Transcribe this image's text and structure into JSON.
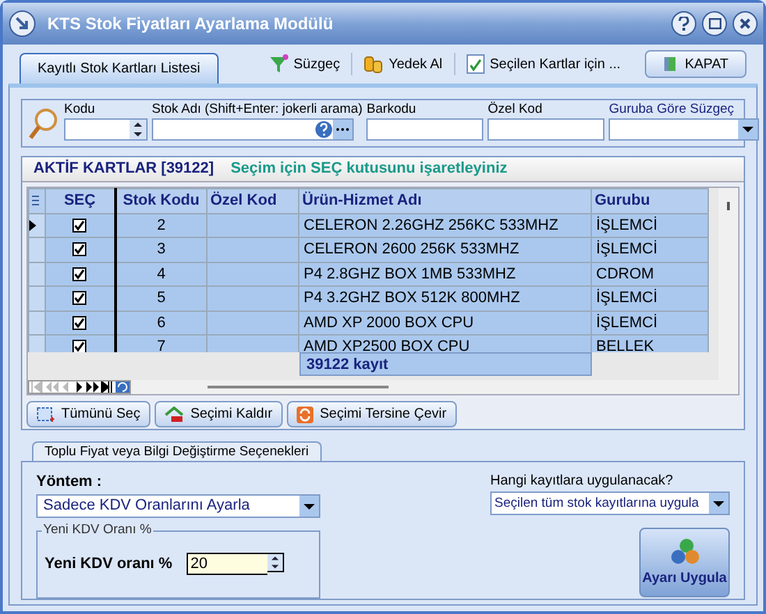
{
  "window": {
    "title": "KTS Stok Fiyatları Ayarlama Modülü"
  },
  "tabs": [
    {
      "label": "Kayıtlı Stok Kartları Listesi",
      "selected": true
    }
  ],
  "toolbar": [
    {
      "label": "Süzgeç",
      "kind": "filter"
    },
    {
      "label": "Yedek Al",
      "kind": "backup"
    },
    {
      "label": "Seçilen Kartlar için ...",
      "kind": "checklist"
    }
  ],
  "close_button": "KAPAT",
  "filters": [
    {
      "label": "Kodu",
      "kind": "spin"
    },
    {
      "label": "Stok Adı (Shift+Enter: jokerli arama)",
      "kind": "search"
    },
    {
      "label": "Barkodu",
      "kind": "text"
    },
    {
      "label": "Özel Kod",
      "kind": "text"
    },
    {
      "label": "Guruba Göre Süzgeç",
      "kind": "combo"
    }
  ],
  "grid": {
    "title": "AKTİF KARTLAR [39122]",
    "hint": "Seçim için SEÇ kutusunu işaretleyiniz",
    "columns": [
      "SEÇ",
      "Stok Kodu",
      "Özel Kod",
      "Ürün-Hizmet Adı",
      "Gurubu"
    ],
    "rows": [
      {
        "current": true,
        "checked": true,
        "code": "2",
        "special": "",
        "name": "CELERON 2.26GHZ 256KC 533MHZ",
        "group": "İŞLEMCİ"
      },
      {
        "current": false,
        "checked": true,
        "code": "3",
        "special": "",
        "name": "CELERON 2600 256K 533MHZ",
        "group": "İŞLEMCİ"
      },
      {
        "current": false,
        "checked": true,
        "code": "4",
        "special": "",
        "name": "P4 2.8GHZ BOX 1MB 533MHZ",
        "group": "CDROM"
      },
      {
        "current": false,
        "checked": true,
        "code": "5",
        "special": "",
        "name": "P4 3.2GHZ BOX 512K 800MHZ",
        "group": "İŞLEMCİ"
      },
      {
        "current": false,
        "checked": true,
        "code": "6",
        "special": "",
        "name": "AMD XP 2000 BOX CPU",
        "group": "İŞLEMCİ"
      },
      {
        "current": false,
        "checked": true,
        "code": "7",
        "special": "",
        "name": "AMD XP2500 BOX CPU",
        "group": "BELLEK"
      }
    ],
    "footer": "39122 kayıt"
  },
  "selection_buttons": [
    {
      "label": "Tümünü Seç",
      "kind": "all"
    },
    {
      "label": "Seçimi Kaldır",
      "kind": "clear"
    },
    {
      "label": "Seçimi Tersine Çevir",
      "kind": "invert"
    }
  ],
  "options": {
    "tab": "Toplu Fiyat veya Bilgi Değiştirme Seçenekleri",
    "method_label": "Yöntem :",
    "method_value": "Sadece KDV Oranlarını Ayarla",
    "group_title": "Yeni KDV Oranı %",
    "rate_label": "Yeni KDV oranı %",
    "rate_value": "20",
    "scope_label": "Hangi kayıtlara uygulanacak?",
    "scope_value": "Seçilen tüm stok kayıtlarına uygula",
    "apply_button": "Ayarı Uygula"
  }
}
